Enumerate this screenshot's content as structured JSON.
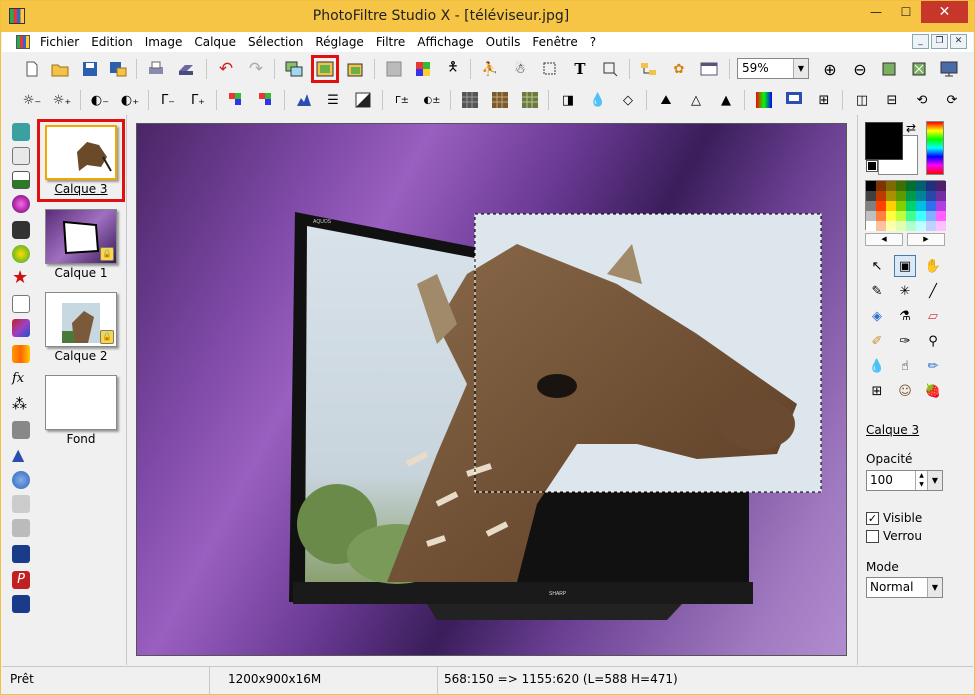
{
  "window": {
    "title": "PhotoFiltre Studio X - [téléviseur.jpg]",
    "min_glyph": "—",
    "max_glyph": "☐",
    "close_glyph": "✕"
  },
  "menu": {
    "items": [
      "Fichier",
      "Edition",
      "Image",
      "Calque",
      "Sélection",
      "Réglage",
      "Filtre",
      "Affichage",
      "Outils",
      "Fenêtre",
      "?"
    ],
    "mdi_buttons": [
      "_",
      "❐",
      "✕"
    ]
  },
  "toolbar": {
    "zoom_value": "59%"
  },
  "layers": {
    "items": [
      {
        "label": "Calque 3",
        "selected": true,
        "locked": false
      },
      {
        "label": "Calque 1",
        "selected": false,
        "locked": true
      },
      {
        "label": "Calque 2",
        "selected": false,
        "locked": true
      },
      {
        "label": "Fond",
        "selected": false,
        "locked": false
      }
    ]
  },
  "canvas": {
    "tv_brand_top": "AQUOS",
    "tv_brand_bottom": "SHARP"
  },
  "right_panel": {
    "layer_name": "Calque 3",
    "opacity_label": "Opacité",
    "opacity_value": "100",
    "visible_label": "Visible",
    "visible_checked": true,
    "lock_label": "Verrou",
    "lock_checked": false,
    "mode_label": "Mode",
    "mode_value": "Normal",
    "fg_color": "#000000",
    "bg_color": "#ffffff"
  },
  "palette": [
    "#000000",
    "#7f3300",
    "#7f6a00",
    "#3f6f00",
    "#006f2f",
    "#00606f",
    "#1f307f",
    "#4f1f6f",
    "#404040",
    "#c03a00",
    "#a89000",
    "#5c9a00",
    "#009a4a",
    "#00849a",
    "#2848a8",
    "#7030a0",
    "#808080",
    "#ff4000",
    "#ffd000",
    "#80d000",
    "#00d070",
    "#00c0e0",
    "#3070f0",
    "#b040e0",
    "#c0c0c0",
    "#ff8040",
    "#ffff40",
    "#c0ff40",
    "#40ff90",
    "#40ffff",
    "#80b0ff",
    "#ff60ff",
    "#ffffff",
    "#ffc0a0",
    "#ffffb0",
    "#e0ffb0",
    "#b0ffd0",
    "#c0ffff",
    "#c0d0ff",
    "#ffc0ff"
  ],
  "statusbar": {
    "state": "Prêt",
    "image_info": "1200x900x16M",
    "selection_info": "568:150 => 1155:620 (L=588  H=471)"
  }
}
